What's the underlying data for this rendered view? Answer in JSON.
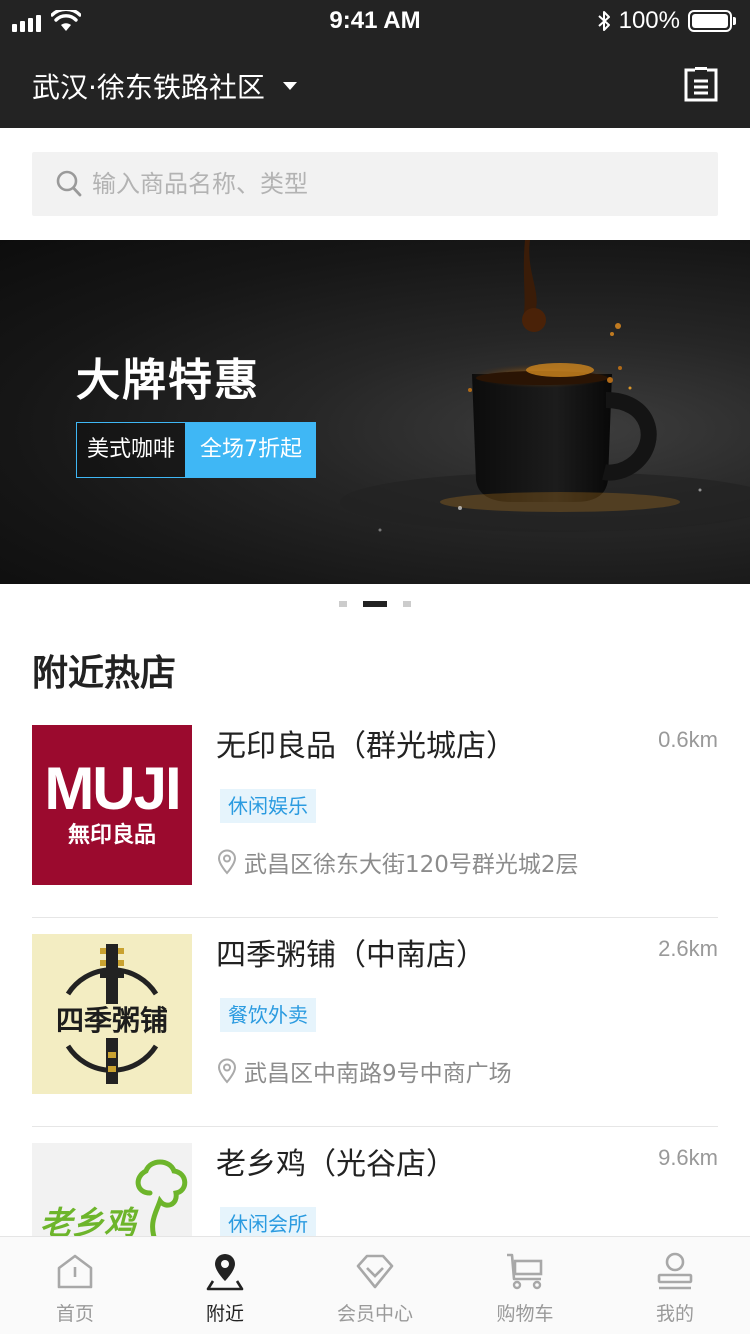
{
  "status_bar": {
    "time": "9:41 AM",
    "battery": "100%"
  },
  "header": {
    "location": "武汉·徐东铁路社区"
  },
  "search": {
    "placeholder": "输入商品名称、类型"
  },
  "banner": {
    "title": "大牌特惠",
    "tag_left": "美式咖啡",
    "tag_right": "全场7折起"
  },
  "section": {
    "title": "附近热店"
  },
  "shops": [
    {
      "name": "无印良品（群光城店）",
      "distance": "0.6km",
      "category": "休闲娱乐",
      "address": "武昌区徐东大街120号群光城2层",
      "logo_line1": "MUJI",
      "logo_line2": "無印良品"
    },
    {
      "name": "四季粥铺（中南店）",
      "distance": "2.6km",
      "category": "餐饮外卖",
      "address": "武昌区中南路9号中商广场",
      "logo_text": "四季粥铺"
    },
    {
      "name": "老乡鸡（光谷店）",
      "distance": "9.6km",
      "category": "休闲会所",
      "address": "",
      "logo_text": "老乡鸡"
    }
  ],
  "tabs": [
    {
      "label": "首页",
      "icon": "home-icon"
    },
    {
      "label": "附近",
      "icon": "location-pin-icon"
    },
    {
      "label": "会员中心",
      "icon": "diamond-icon"
    },
    {
      "label": "购物车",
      "icon": "cart-icon"
    },
    {
      "label": "我的",
      "icon": "user-icon"
    }
  ],
  "colors": {
    "accent": "#3fb7f5",
    "header_bg": "#232323",
    "tag_bg": "#e6f4fc",
    "tag_text": "#2b9be0"
  }
}
